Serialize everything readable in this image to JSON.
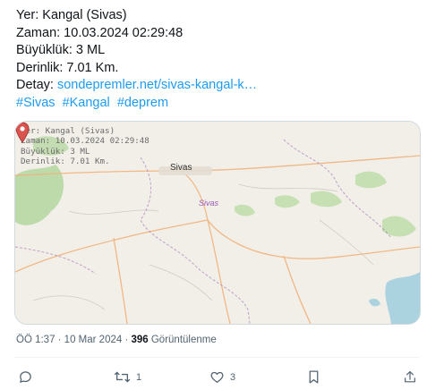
{
  "post": {
    "lines": [
      "Yer: Kangal (Sivas)",
      "Zaman: 10.03.2024 02:29:48",
      "Büyüklük: 3 ML",
      "Derinlik: 7.01 Km."
    ],
    "detail_label": "Detay: ",
    "detail_link": "sondepremler.net/sivas-kangal-k…",
    "hashtags": [
      "#Sivas",
      "#Kangal",
      "#deprem"
    ]
  },
  "map": {
    "overlay_lines": [
      "Yer: Kangal (Sivas)",
      "Zaman: 10.03.2024 02:29:48",
      "Büyüklük: 3 ML",
      "Derinlik: 7.01 Km."
    ],
    "city_label": "Sivas",
    "region_label": "Sivas",
    "colors": {
      "land": "#f2efe9",
      "forest": "#b7d7a3",
      "water": "#aad3df",
      "road": "#f0b27a",
      "border": "#9b6bb3",
      "pin": "#d9534f"
    }
  },
  "meta": {
    "time": "ÖÖ 1:37 · 10 Mar 2024 · ",
    "views_count": "396",
    "views_label": " Görüntülenme"
  },
  "actions": {
    "reply_icon": "reply-icon",
    "retweet_count": "1",
    "like_count": "3",
    "bookmark_icon": "bookmark-icon",
    "share_icon": "share-icon"
  }
}
